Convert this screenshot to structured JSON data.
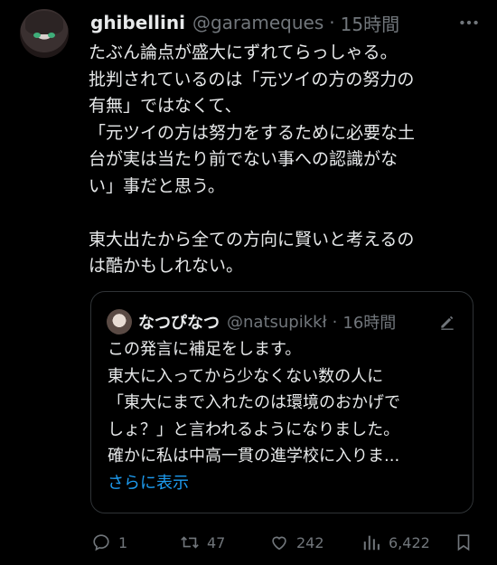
{
  "tweet": {
    "display_name": "ghibellini",
    "handle": "@garameques",
    "separator": "·",
    "time": "15時間",
    "lines": [
      "たぶん論点が盛大にずれてらっしゃる。",
      "批判されているのは「元ツイの方の努力の",
      "有無」ではなくて、",
      "「元ツイの方は努力をするために必要な土",
      "台が実は当たり前でない事への認識がな",
      "い」事だと思う。",
      "",
      "東大出たから全ての方向に賢いと考えるの",
      "は酷かもしれない。"
    ]
  },
  "quote": {
    "display_name": "なつぴなつ",
    "handle": "@natsupikkł",
    "separator": "·",
    "time": "16時間",
    "lines": [
      "この発言に補足をします。",
      "東大に入ってから少なくない数の人に",
      "「東大にまで入れたのは環境のおかげで",
      "しょ？」と言われるようになりました。",
      "確かに私は中高一貫の進学校に入りま..."
    ],
    "show_more": "さらに表示"
  },
  "actions": {
    "replies": "1",
    "retweets": "47",
    "likes": "242",
    "views": "6,422"
  }
}
